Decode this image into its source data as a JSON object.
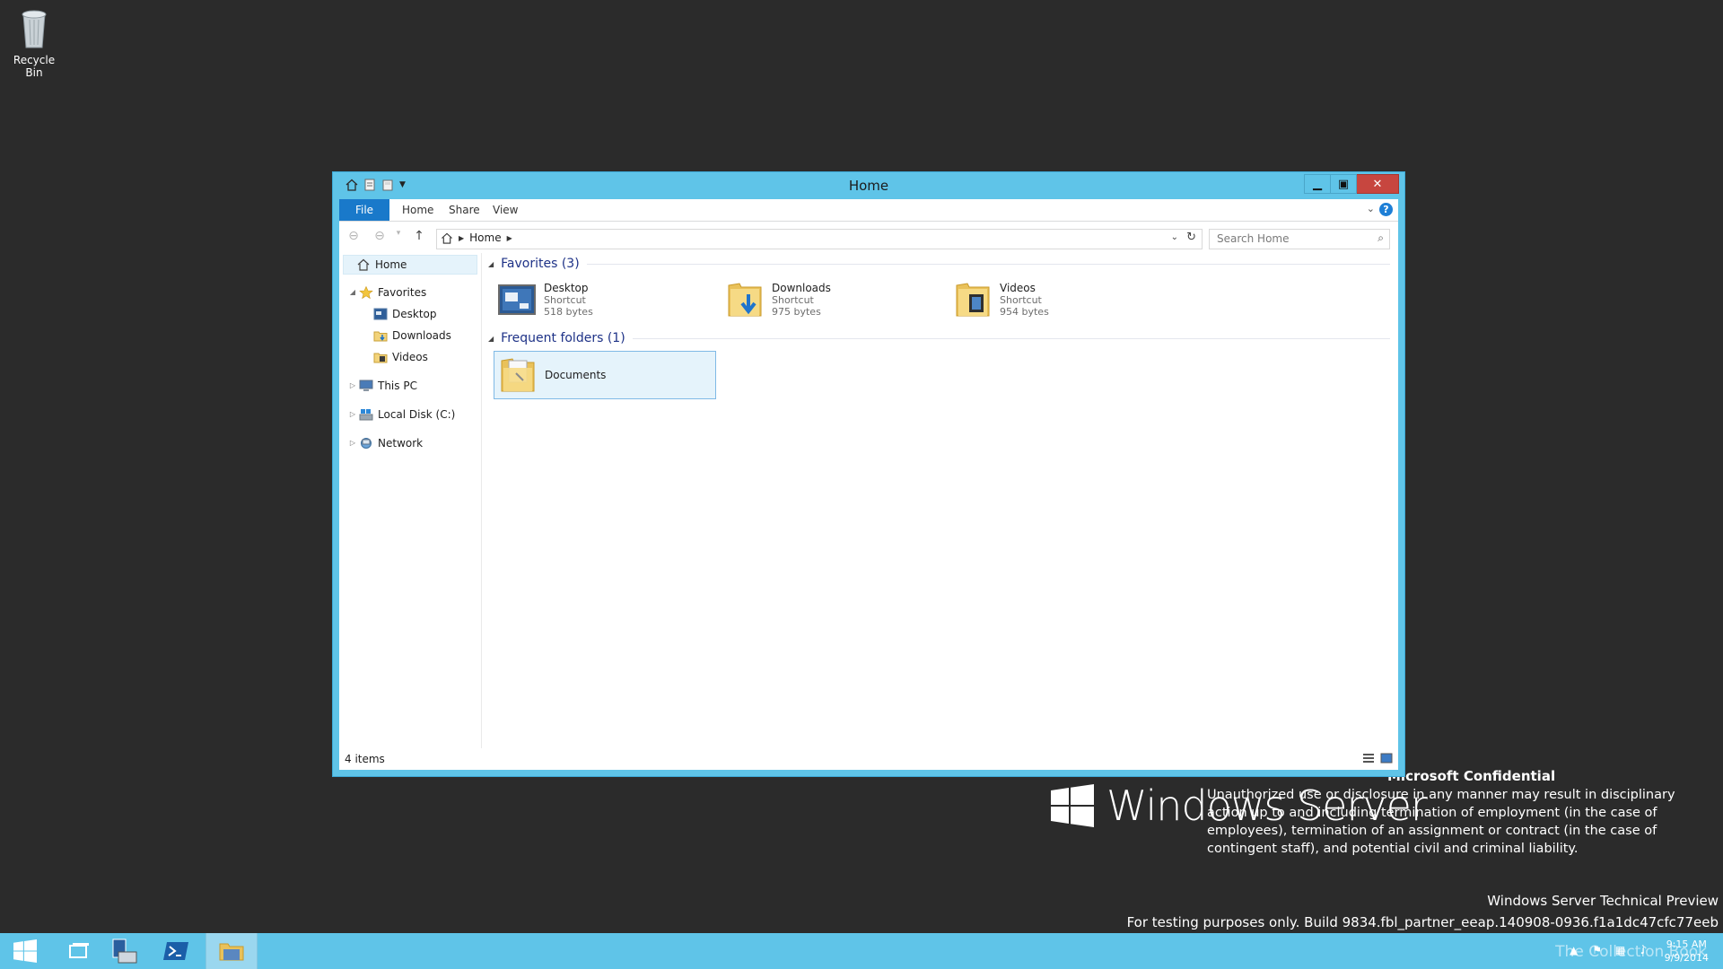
{
  "desktop": {
    "recycle_bin_label": "Recycle Bin",
    "brand_text": "Windows Server",
    "confidential_title": "Microsoft Confidential",
    "confidential_body": "Unauthorized use or disclosure in any manner may result in disciplinary action up to and including termination of employment (in the case of employees), termination of an assignment or contract (in the case of contingent staff), and potential civil and criminal liability.",
    "preview_line": "Windows Server Technical Preview",
    "build_line": "For testing purposes only. Build 9834.fbl_partner_eeap.140908-0936.f1a1dc47cfc77eeb"
  },
  "window": {
    "title": "Home",
    "accent_color": "#5fc4e8",
    "ribbon_tabs": [
      "File",
      "Home",
      "Share",
      "View"
    ],
    "address_crumb": "Home",
    "search_placeholder": "Search Home",
    "status_text": "4 items"
  },
  "nav_tree": {
    "home": "Home",
    "favorites": "Favorites",
    "desktop": "Desktop",
    "downloads": "Downloads",
    "videos": "Videos",
    "this_pc": "This PC",
    "local_disk": "Local Disk (C:)",
    "network": "Network"
  },
  "content": {
    "favorites_header": "Favorites (3)",
    "favorites": [
      {
        "name": "Desktop",
        "type": "Shortcut",
        "size": "518 bytes",
        "icon": "desktop-icon"
      },
      {
        "name": "Downloads",
        "type": "Shortcut",
        "size": "975 bytes",
        "icon": "downloads-folder-icon"
      },
      {
        "name": "Videos",
        "type": "Shortcut",
        "size": "954 bytes",
        "icon": "videos-folder-icon"
      }
    ],
    "frequent_header": "Frequent folders (1)",
    "frequent": [
      {
        "name": "Documents",
        "icon": "documents-folder-icon"
      }
    ]
  },
  "taskbar": {
    "clock_time": "9:15 AM",
    "clock_date": "9/9/2014",
    "watermark": "The Collection Book"
  }
}
